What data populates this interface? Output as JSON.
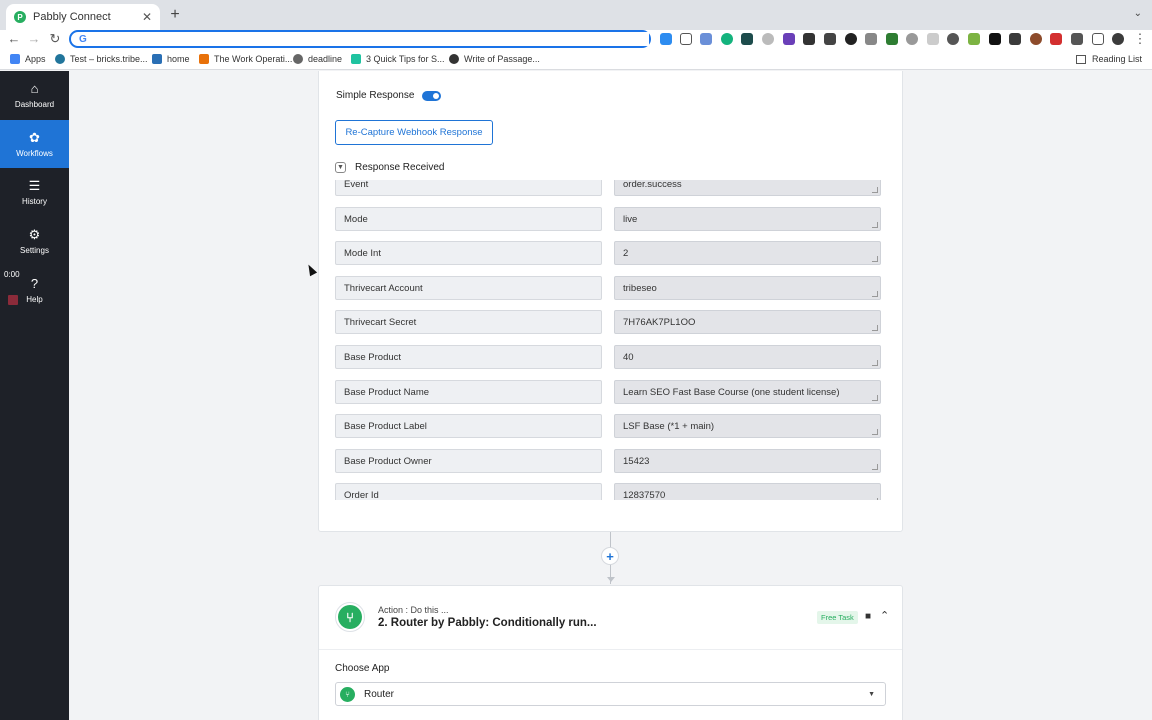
{
  "browser": {
    "tab_title": "Pabbly Connect",
    "tab_favicon": "P",
    "new_tab": "+",
    "close_tab": "✕",
    "address_value": "",
    "google_glyph": "G",
    "bookmarks": [
      "Apps",
      "Test – bricks.tribe...",
      "home",
      "The Work Operati...",
      "deadline",
      "3 Quick Tips for S...",
      "Write of Passage..."
    ],
    "reading_list": "Reading List"
  },
  "sidebar": {
    "items": [
      {
        "label": "Dashboard",
        "icon": "⌂"
      },
      {
        "label": "Workflows",
        "icon": "✿"
      },
      {
        "label": "History",
        "icon": "☰"
      },
      {
        "label": "Settings",
        "icon": "⚙"
      },
      {
        "label": "Help",
        "icon": "?"
      }
    ],
    "timer": "0:00"
  },
  "webhook": {
    "simple_response_label": "Simple Response",
    "recapture_label": "Re-Capture Webhook Response",
    "response_received_label": "Response Received",
    "rows": [
      {
        "key": "Event",
        "value": "order.success"
      },
      {
        "key": "Mode",
        "value": "live"
      },
      {
        "key": "Mode Int",
        "value": "2"
      },
      {
        "key": "Thrivecart Account",
        "value": "tribeseo"
      },
      {
        "key": "Thrivecart Secret",
        "value": "7H76AK7PL1OO"
      },
      {
        "key": "Base Product",
        "value": "40"
      },
      {
        "key": "Base Product Name",
        "value": "Learn SEO Fast Base Course (one student license)"
      },
      {
        "key": "Base Product Label",
        "value": "LSF Base (*1 + main)"
      },
      {
        "key": "Base Product Owner",
        "value": "15423"
      },
      {
        "key": "Order Id",
        "value": "12837570"
      }
    ]
  },
  "add_step": "+",
  "action_step": {
    "subtitle": "Action : Do this ...",
    "title": "2. Router by Pabbly: Conditionally run...",
    "badge": "Free Task",
    "choose_app_label": "Choose App",
    "app_value": "Router",
    "caret": "⌃",
    "dropdown_arrow": "▼"
  },
  "colors": {
    "accent": "#1f74d6",
    "sidebar_bg": "#1e2128",
    "brand_green": "#27ae60"
  }
}
